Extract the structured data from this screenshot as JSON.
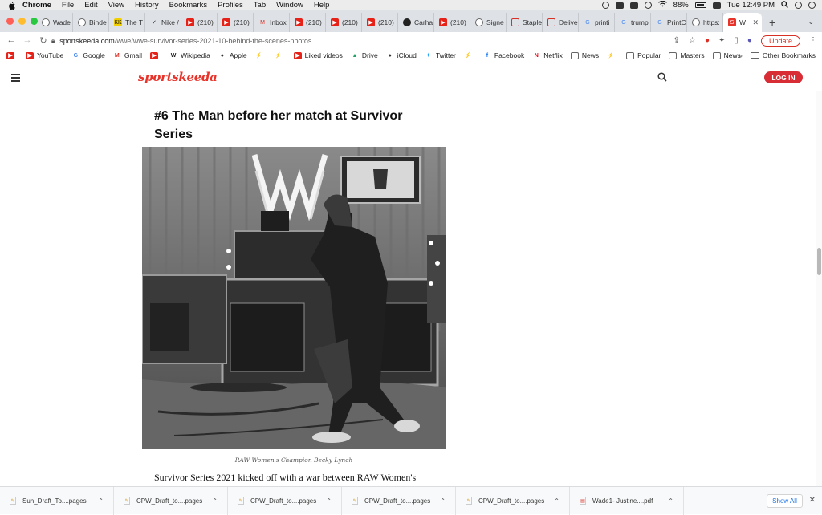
{
  "menubar": {
    "app": "Chrome",
    "items": [
      "File",
      "Edit",
      "View",
      "History",
      "Bookmarks",
      "Profiles",
      "Tab",
      "Window",
      "Help"
    ],
    "battery": "88%",
    "clock": "Tue 12:49 PM"
  },
  "tabs": [
    {
      "label": "Wade",
      "icon": "globe-icon"
    },
    {
      "label": "Binde",
      "icon": "globe-icon"
    },
    {
      "label": "The T",
      "icon": "kk-icon"
    },
    {
      "label": "Nike /",
      "icon": "nike-icon"
    },
    {
      "label": "(210)",
      "icon": "youtube-icon"
    },
    {
      "label": "(210)",
      "icon": "youtube-icon"
    },
    {
      "label": "Inbox",
      "icon": "gmail-icon"
    },
    {
      "label": "(210)",
      "icon": "youtube-icon"
    },
    {
      "label": "(210)",
      "icon": "youtube-icon"
    },
    {
      "label": "(210)",
      "icon": "youtube-icon"
    },
    {
      "label": "Carha",
      "icon": "carhartt-icon"
    },
    {
      "label": "(210)",
      "icon": "youtube-icon"
    },
    {
      "label": "Signe",
      "icon": "globe-icon"
    },
    {
      "label": "Staple",
      "icon": "staples-icon"
    },
    {
      "label": "Delive",
      "icon": "staples-icon"
    },
    {
      "label": "printi",
      "icon": "google-icon"
    },
    {
      "label": "trump",
      "icon": "google-icon"
    },
    {
      "label": "PrintC",
      "icon": "google-icon"
    },
    {
      "label": "https:",
      "icon": "globe-icon"
    },
    {
      "label": "W",
      "icon": "sportskeeda-icon",
      "active": true
    }
  ],
  "toolbar": {
    "url_domain": "sportskeeda.com",
    "url_path": "/wwe/wwe-survivor-series-2021-10-behind-the-scenes-photos",
    "update_label": "Update"
  },
  "bookmarks": [
    {
      "label": "",
      "icon": "youtube-icon"
    },
    {
      "label": "YouTube",
      "icon": "youtube-icon"
    },
    {
      "label": "Google",
      "icon": "google-icon"
    },
    {
      "label": "Gmail",
      "icon": "gmail-icon"
    },
    {
      "label": "",
      "icon": "youtube-icon"
    },
    {
      "label": "Wikipedia",
      "icon": "wikipedia-icon"
    },
    {
      "label": "Apple",
      "icon": "apple-icon"
    },
    {
      "label": "",
      "icon": "bolt-icon"
    },
    {
      "label": "",
      "icon": "bolt-icon"
    },
    {
      "label": "Liked videos",
      "icon": "youtube-icon"
    },
    {
      "label": "Drive",
      "icon": "drive-icon"
    },
    {
      "label": "iCloud",
      "icon": "apple-icon"
    },
    {
      "label": "Twitter",
      "icon": "twitter-icon"
    },
    {
      "label": "",
      "icon": "bolt-icon"
    },
    {
      "label": "Facebook",
      "icon": "facebook-icon"
    },
    {
      "label": "Netflix",
      "icon": "netflix-icon"
    },
    {
      "label": "News",
      "icon": "folder-icon"
    },
    {
      "label": "",
      "icon": "bolt-icon"
    },
    {
      "label": "Popular",
      "icon": "folder-icon"
    },
    {
      "label": "Masters",
      "icon": "folder-icon"
    },
    {
      "label": "News",
      "icon": "folder-icon"
    }
  ],
  "bookmarks_more": "»",
  "bookmarks_other": "Other Bookmarks",
  "site": {
    "logo": "sportskeeda",
    "login": "LOG IN"
  },
  "article": {
    "heading": "#6 The Man before her match at Survivor Series",
    "caption": "RAW Women's Champion Becky Lynch",
    "body": "Survivor Series 2021 kicked off with a war between RAW Women's"
  },
  "downloads": {
    "items": [
      {
        "name": "Sun_Draft_To....pages",
        "type": "pages"
      },
      {
        "name": "CPW_Draft_to....pages",
        "type": "pages"
      },
      {
        "name": "CPW_Draft_to....pages",
        "type": "pages"
      },
      {
        "name": "CPW_Draft_to....pages",
        "type": "pages"
      },
      {
        "name": "CPW_Draft_to....pages",
        "type": "pages"
      },
      {
        "name": "Wade1- Justine....pdf",
        "type": "pdf"
      }
    ],
    "show_all": "Show All"
  },
  "colors": {
    "brand": "#e8332a",
    "login": "#d82d35",
    "update": "#d93025"
  }
}
